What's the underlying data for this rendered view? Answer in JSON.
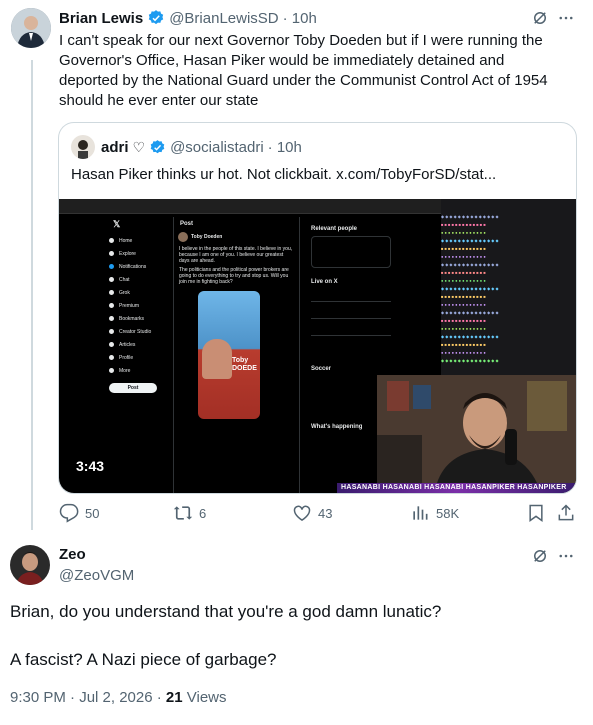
{
  "tweet": {
    "author": "Brian Lewis",
    "handle": "@BrianLewisSD",
    "time": "· 10h",
    "text": "I can't speak for our next Governor Toby Doeden but if I were running the Governor's Office, Hasan Piker would be immediately detained and deported by the National Guard under the Communist Control Act of 1954 should he ever enter our state",
    "verified_color": "#1d9bf0"
  },
  "quote": {
    "author": "adri",
    "author_symbol": "♡",
    "handle": "@socialistadri",
    "time": "· 10h",
    "text": "Hasan Piker thinks ur hot. Not clickbait.  x.com/TobyForSD/stat...",
    "video_time": "3:43",
    "screen": {
      "nav_items": [
        "Home",
        "Explore",
        "Notifications",
        "Chat",
        "Grok",
        "Premium",
        "Bookmarks",
        "Creator Studio",
        "Articles",
        "Profile",
        "More"
      ],
      "post_button": "Post",
      "post_header": "Post",
      "post_author": "Toby Doeden",
      "post_lines": [
        "I believe in the people of this state. I believe in you, because I am one of you. I believe our greatest days are ahead.",
        "The politicians and the political power brokers are going to do everything to try and stop us. Will you join me in fighting back?"
      ],
      "sign_text": "Toby DOEDE",
      "relevant_header": "Relevant people",
      "live_header": "Live on X",
      "soccer_header": "Soccer",
      "whats_happening": "What's happening",
      "banner_text": "HASANABI HASANABI HASANABI HASANPIKER HASANPIKER"
    }
  },
  "actions": {
    "replies": "50",
    "reposts": "6",
    "likes": "43",
    "views": "58K"
  },
  "reply": {
    "author": "Zeo",
    "handle": "@ZeoVGM",
    "text1": "Brian, do you understand that you're a god damn lunatic?",
    "text2": "A fascist? A Nazi piece of garbage?",
    "timestamp": "9:30 PM · Jul 2, 2026 · ",
    "views_count": "21",
    "views_label": " Views"
  },
  "icons": [
    "grok-icon",
    "more-icon",
    "verified-icon",
    "reply-icon",
    "repost-icon",
    "like-icon",
    "views-icon",
    "bookmark-icon",
    "share-icon"
  ]
}
